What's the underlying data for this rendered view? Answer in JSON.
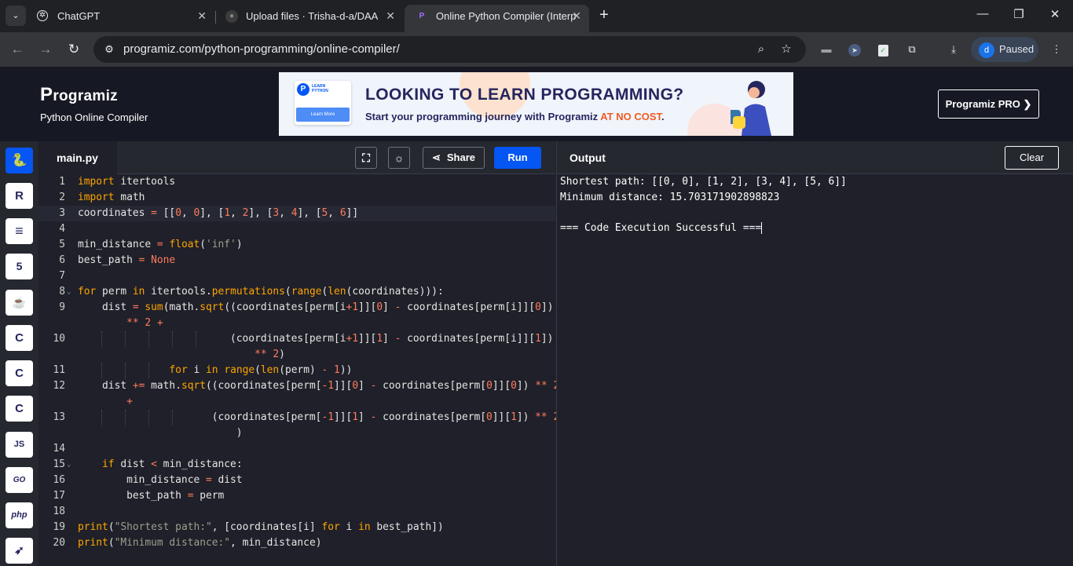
{
  "browser": {
    "tabs": [
      {
        "title": "ChatGPT",
        "icon": "chatgpt-icon"
      },
      {
        "title": "Upload files · Trisha-d-a/DAA",
        "icon": "github-icon"
      },
      {
        "title": "Online Python Compiler (Interp",
        "icon": "programiz-icon"
      }
    ],
    "url": "programiz.com/python-programming/online-compiler/",
    "profile_initial": "d",
    "profile_label": "Paused"
  },
  "header": {
    "logo": "rogramiz",
    "logo_mark": "P",
    "subtitle": "Python Online Compiler",
    "pro_button": "Programiz PRO ❯"
  },
  "banner": {
    "card_line1": "LEARN",
    "card_line2": "PYTHON",
    "card_button": "Learn More",
    "headline": "LOOKING TO LEARN PROGRAMMING?",
    "sub_text": "Start your programming journey with Programiz ",
    "sub_highlight": "AT NO COST",
    "sub_end": "."
  },
  "languages": [
    {
      "name": "python",
      "glyph": "🐍"
    },
    {
      "name": "r",
      "glyph": "R"
    },
    {
      "name": "sql",
      "glyph": "≡"
    },
    {
      "name": "html",
      "glyph": "5"
    },
    {
      "name": "java",
      "glyph": "☕"
    },
    {
      "name": "c",
      "glyph": "C"
    },
    {
      "name": "cpp",
      "glyph": "C"
    },
    {
      "name": "csharp",
      "glyph": "C"
    },
    {
      "name": "js",
      "glyph": "JS"
    },
    {
      "name": "go",
      "glyph": "GO"
    },
    {
      "name": "php",
      "glyph": "php"
    },
    {
      "name": "swift",
      "glyph": "➶"
    }
  ],
  "editor": {
    "filename": "main.py",
    "share_label": "Share",
    "run_label": "Run",
    "line_numbers": [
      "1",
      "2",
      "3",
      "4",
      "5",
      "6",
      "7",
      "8",
      "9",
      "10",
      "11",
      "12",
      "13",
      "14",
      "15",
      "16",
      "17",
      "18",
      "19",
      "20"
    ]
  },
  "output": {
    "title": "Output",
    "clear_label": "Clear",
    "lines": [
      "Shortest path: [[0, 0], [1, 2], [3, 4], [5, 6]]",
      "Minimum distance: 15.703171902898823",
      "",
      "=== Code Execution Successful ==="
    ]
  }
}
